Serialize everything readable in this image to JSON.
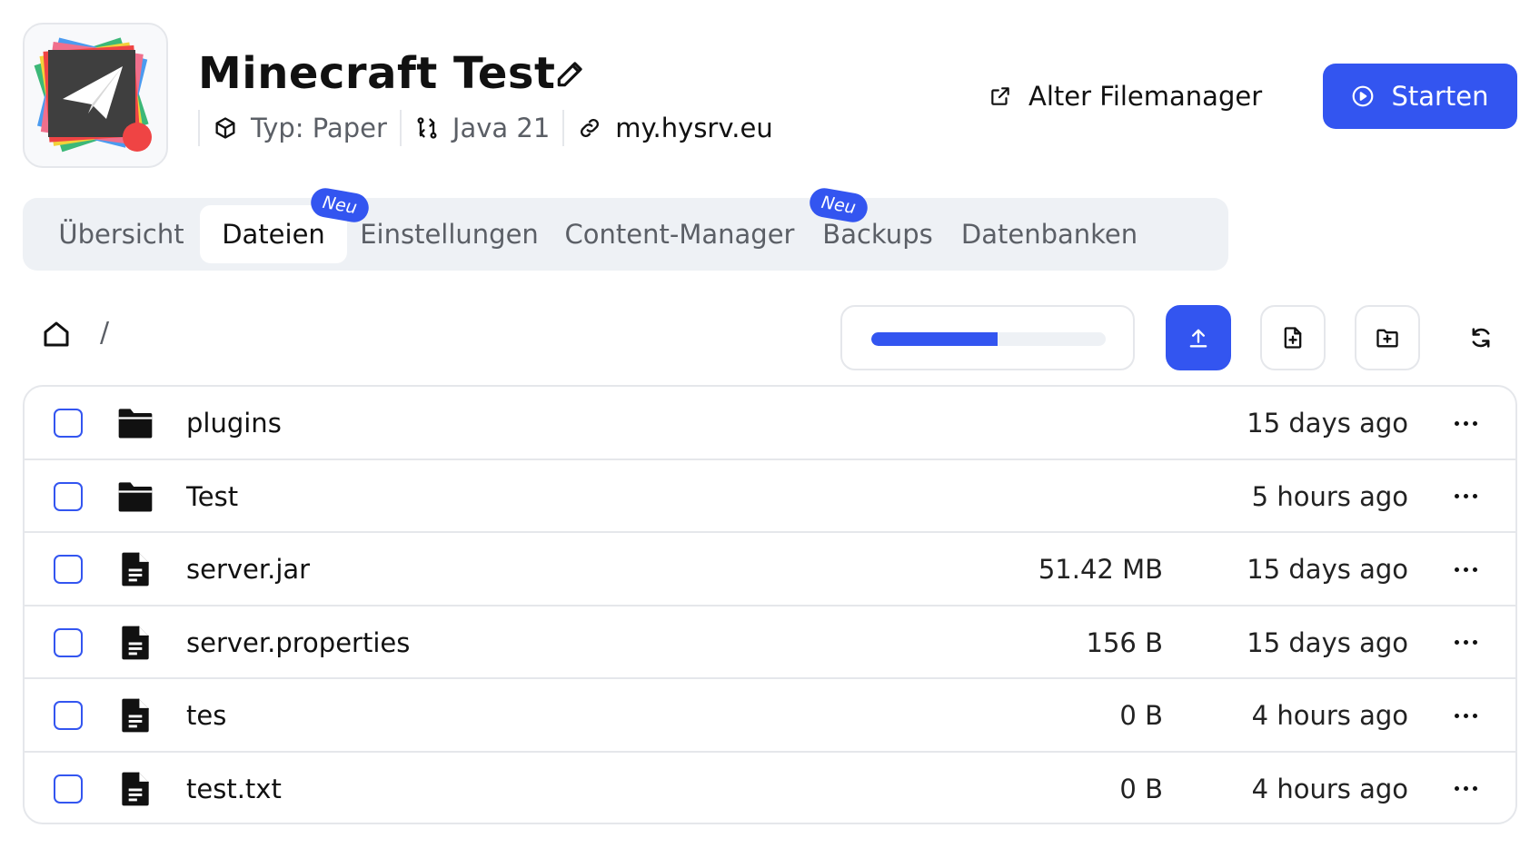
{
  "header": {
    "title": "Minecraft Test",
    "meta": [
      {
        "icon": "cube-icon",
        "text": "Typ: Paper"
      },
      {
        "icon": "git-compare-icon",
        "text": "Java 21"
      },
      {
        "icon": "link-icon",
        "text": "my.hysrv.eu"
      }
    ],
    "old_filemanager_label": "Alter Filemanager",
    "start_label": "Starten"
  },
  "tabs": [
    {
      "label": "Übersicht",
      "active": false
    },
    {
      "label": "Dateien",
      "active": true,
      "badge": "Neu"
    },
    {
      "label": "Einstellungen",
      "active": false
    },
    {
      "label": "Content-Manager",
      "active": false,
      "badge": "Neu"
    },
    {
      "label": "Backups",
      "active": false
    },
    {
      "label": "Datenbanken",
      "active": false
    }
  ],
  "breadcrumb": {
    "separator": "/"
  },
  "toolbar": {
    "progress": 0.54,
    "buttons": [
      "upload-icon",
      "new-file-icon",
      "new-folder-icon",
      "refresh-icon"
    ]
  },
  "files": [
    {
      "type": "folder",
      "name": "plugins",
      "size": "",
      "modified": "15 days ago"
    },
    {
      "type": "folder",
      "name": "Test",
      "size": "",
      "modified": "5 hours ago"
    },
    {
      "type": "file",
      "name": "server.jar",
      "size": "51.42 MB",
      "modified": "15 days ago"
    },
    {
      "type": "file",
      "name": "server.properties",
      "size": "156 B",
      "modified": "15 days ago"
    },
    {
      "type": "file",
      "name": "tes",
      "size": "0 B",
      "modified": "4 hours ago"
    },
    {
      "type": "file",
      "name": "test.txt",
      "size": "0 B",
      "modified": "4 hours ago"
    }
  ],
  "colors": {
    "accent": "#3355f0",
    "border": "#e5e7eb",
    "muted": "#5b5f66",
    "tab_bg": "#eef1f5",
    "status_dot": "#ef4444"
  }
}
